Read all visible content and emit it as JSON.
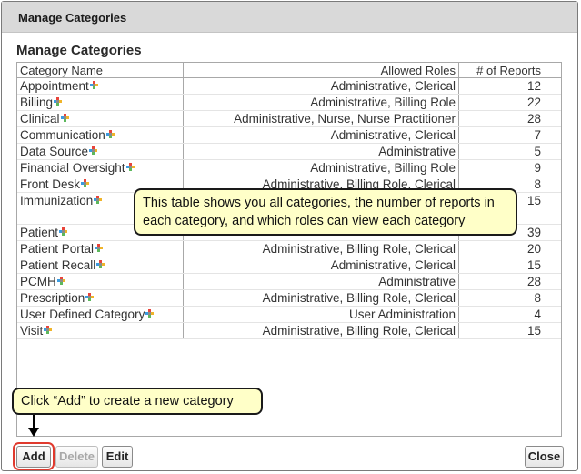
{
  "dialog": {
    "title": "Manage Categories",
    "section_title": "Manage Categories"
  },
  "table": {
    "columns": [
      "Category Name",
      "Allowed Roles",
      "# of Reports"
    ],
    "rows": [
      {
        "name": "Appointment",
        "roles": "Administrative, Clerical",
        "reports": "12"
      },
      {
        "name": "Billing",
        "roles": "Administrative, Billing Role",
        "reports": "22"
      },
      {
        "name": "Clinical",
        "roles": "Administrative, Nurse, Nurse Practitioner",
        "reports": "28"
      },
      {
        "name": "Communication",
        "roles": "Administrative, Clerical",
        "reports": "7"
      },
      {
        "name": "Data Source",
        "roles": "Administrative",
        "reports": "5"
      },
      {
        "name": "Financial Oversight",
        "roles": "Administrative, Billing Role",
        "reports": "9"
      },
      {
        "name": "Front Desk",
        "roles": "Administrative, Billing Role, Clerical",
        "reports": "8"
      },
      {
        "name": "Immunization",
        "roles": "",
        "reports": "15"
      },
      {
        "name": "Patient",
        "roles": "",
        "reports": "39"
      },
      {
        "name": "Patient Portal",
        "roles": "Administrative, Billing Role, Clerical",
        "reports": "20"
      },
      {
        "name": "Patient Recall",
        "roles": "Administrative, Clerical",
        "reports": "15"
      },
      {
        "name": "PCMH",
        "roles": "Administrative",
        "reports": "28"
      },
      {
        "name": "Prescription",
        "roles": "Administrative, Billing Role, Clerical",
        "reports": "8"
      },
      {
        "name": "User Defined Category",
        "roles": "User Administration",
        "reports": "4"
      },
      {
        "name": "Visit",
        "roles": "Administrative, Billing Role, Clerical",
        "reports": "15"
      }
    ]
  },
  "callouts": {
    "table_note": "This table shows you all categories, the number of reports in each category, and which roles can view each category",
    "add_note": "Click “Add” to create a new category"
  },
  "buttons": {
    "add": "Add",
    "delete": "Delete",
    "edit": "Edit",
    "close": "Close"
  },
  "icons": {
    "category_badge": "colored-plus-icon"
  },
  "colors": {
    "callout_bg": "#ffffc8",
    "highlight_ring": "#e03a2e"
  }
}
